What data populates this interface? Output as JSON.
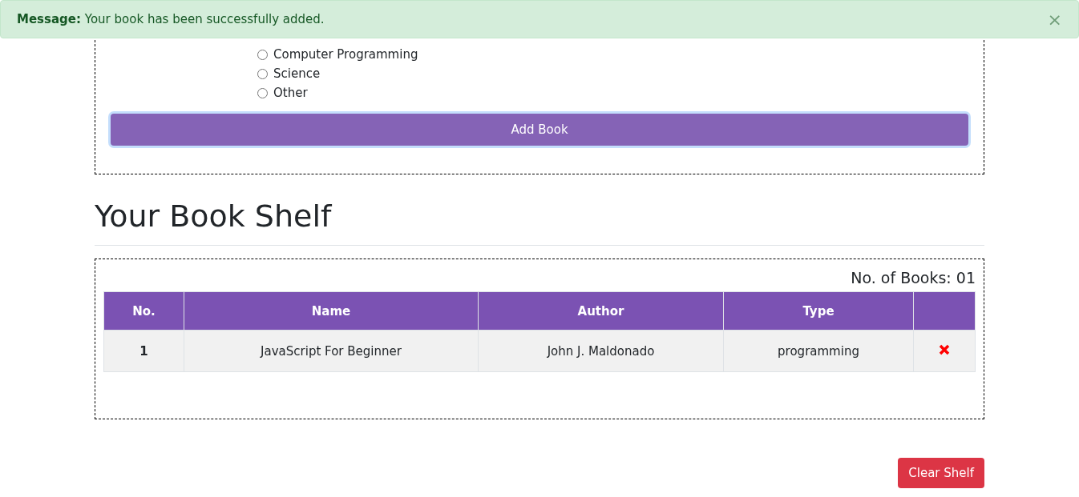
{
  "alert": {
    "label": "Message:",
    "text": "Your book has been successfully added.",
    "close": "×"
  },
  "type_options": [
    {
      "label": "Computer Programming",
      "selected": false
    },
    {
      "label": "Science",
      "selected": false
    },
    {
      "label": "Other",
      "selected": false
    }
  ],
  "add_button": "Add Book",
  "shelf": {
    "title": "Your Book Shelf",
    "count": "No. of Books: 01",
    "columns": [
      "No.",
      "Name",
      "Author",
      "Type"
    ],
    "rows": [
      {
        "no": "1",
        "name": "JavaScript For Beginner",
        "author": "John J. Maldonado",
        "type": "programming"
      }
    ]
  },
  "clear_button": "Clear Shelf"
}
